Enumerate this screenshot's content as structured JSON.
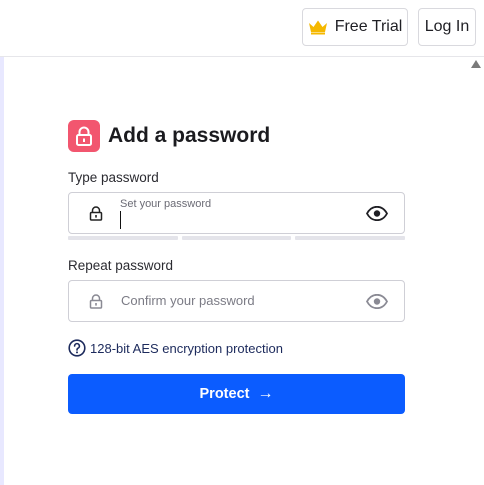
{
  "header": {
    "free_trial_label": "Free Trial",
    "login_label": "Log In"
  },
  "form": {
    "title": "Add a password",
    "type_password_label": "Type password",
    "type_password_placeholder": "Set your password",
    "repeat_password_label": "Repeat password",
    "repeat_password_placeholder": "Confirm your password",
    "info_text": "128-bit AES encryption protection",
    "protect_label": "Protect",
    "protect_arrow": "→"
  },
  "colors": {
    "accent": "#0b5cff",
    "lock_badge": "#f2566f",
    "crown": "#f5b800"
  }
}
